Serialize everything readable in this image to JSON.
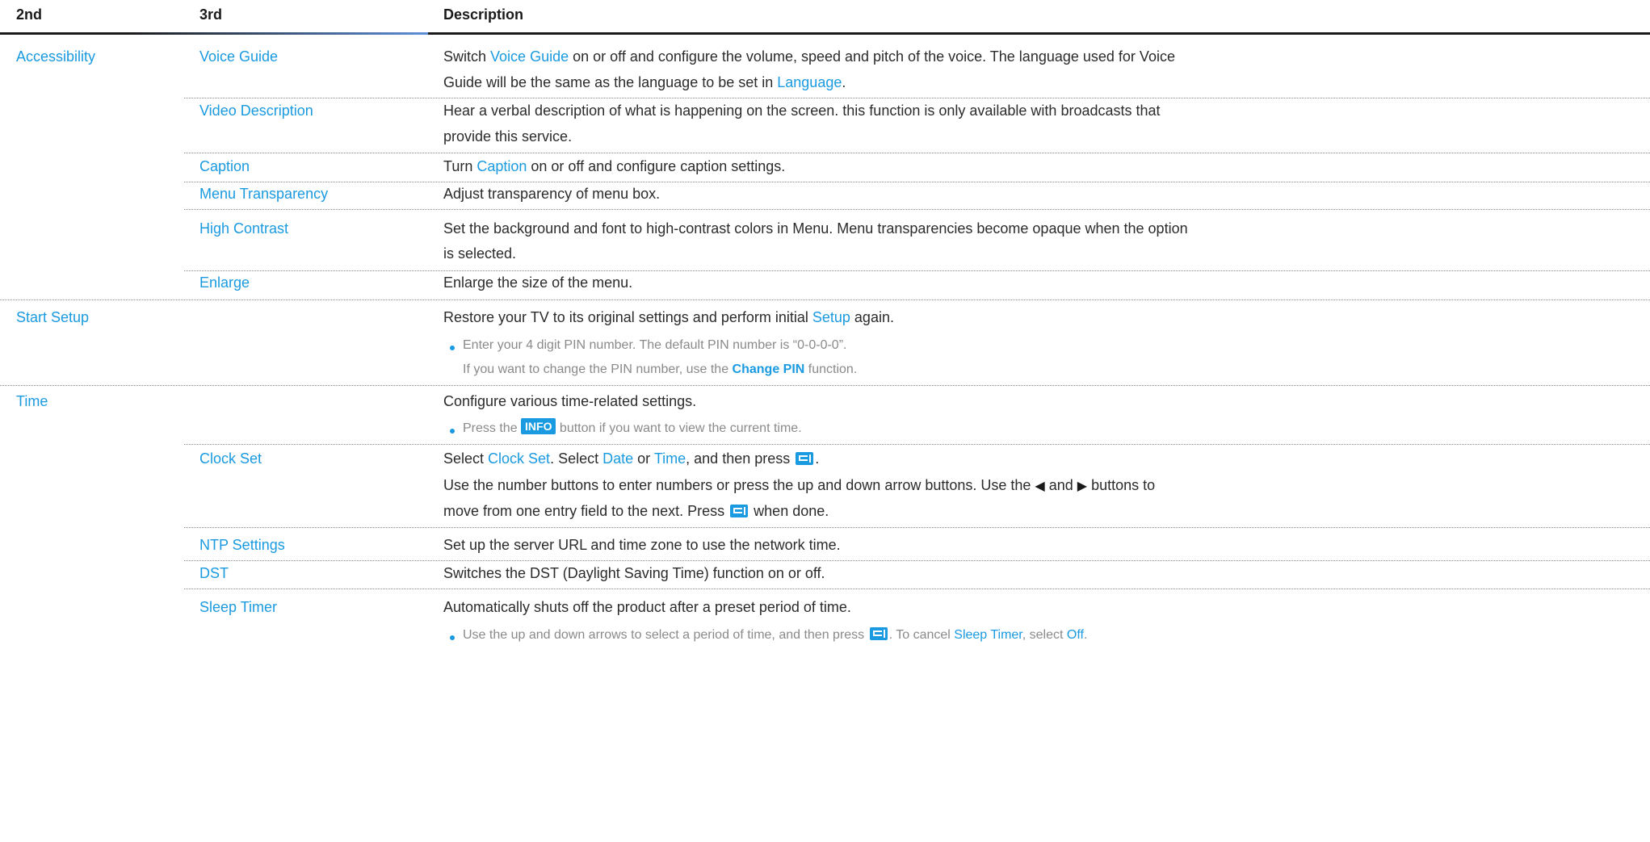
{
  "header": {
    "col2": "2nd",
    "col3": "3rd",
    "desc": "Description"
  },
  "accessibility": {
    "label": "Accessibility",
    "voice_guide": {
      "name": "Voice Guide",
      "l1_a": "Switch ",
      "l1_link": "Voice Guide",
      "l1_b": " on or off and configure the volume, speed and pitch of the voice. The language used for Voice",
      "l2_a": "Guide will be the same as the language to be set in ",
      "l2_link": "Language",
      "l2_b": "."
    },
    "video_description": {
      "name": "Video Description",
      "l1": "Hear a verbal description of what is happening on the screen. this function is only available with broadcasts that",
      "l2": "provide this service."
    },
    "caption": {
      "name": "Caption",
      "l1_a": "Turn ",
      "l1_link": "Caption",
      "l1_b": " on or off and configure caption settings."
    },
    "menu_transparency": {
      "name": "Menu Transparency",
      "l1": "Adjust transparency of menu box."
    },
    "high_contrast": {
      "name": "High Contrast",
      "l1": "Set the background and font to high-contrast colors in Menu. Menu transparencies become opaque when the option",
      "l2": "is selected."
    },
    "enlarge": {
      "name": "Enlarge",
      "l1": "Enlarge the size of the menu."
    }
  },
  "start_setup": {
    "label": "Start Setup",
    "l1_a": "Restore your TV to its original settings and perform initial ",
    "l1_link": "Setup",
    "l1_b": " again.",
    "note1": "Enter your 4 digit PIN number. The default PIN number is “0-0-0-0”.",
    "note2_a": "If you want to change the PIN number, use the ",
    "note2_link": "Change PIN",
    "note2_b": " function."
  },
  "time": {
    "label": "Time",
    "l1": "Configure various time-related settings.",
    "note_a": "Press the ",
    "note_badge": "INFO",
    "note_b": " button if you want to view the current time.",
    "clock_set": {
      "name": "Clock Set",
      "l1_a": "Select ",
      "l1_link1": "Clock Set",
      "l1_b": ". Select ",
      "l1_link2": "Date",
      "l1_c": " or ",
      "l1_link3": "Time",
      "l1_d": ", and then press ",
      "l1_e": ".",
      "l2_a": "Use the number buttons to enter numbers or press the up and down arrow buttons. Use the ",
      "l2_left": "◀",
      "l2_b": " and ",
      "l2_right": "▶",
      "l2_c": " buttons to",
      "l3_a": "move from one entry field to the next. Press ",
      "l3_b": " when done."
    },
    "ntp": {
      "name": "NTP Settings",
      "l1": "Set up the server URL and time zone to use the network time."
    },
    "dst": {
      "name": "DST",
      "l1": "Switches the DST (Daylight Saving Time) function on or off."
    },
    "sleep_timer": {
      "name": "Sleep Timer",
      "l1": "Automatically shuts off the product after a preset period of time.",
      "note_a": "Use the up and down arrows to select a period of time, and then press ",
      "note_b": ". To cancel ",
      "note_link1": "Sleep Timer",
      "note_c": ", select ",
      "note_link2": "Off",
      "note_d": "."
    }
  },
  "colors": {
    "link": "#1a9ae0",
    "text": "#2b2b2b",
    "note": "#8a8a8a",
    "rule": "#1a1a1a"
  },
  "icons": {
    "enter": "enter-icon",
    "bullet": "bullet-icon"
  }
}
